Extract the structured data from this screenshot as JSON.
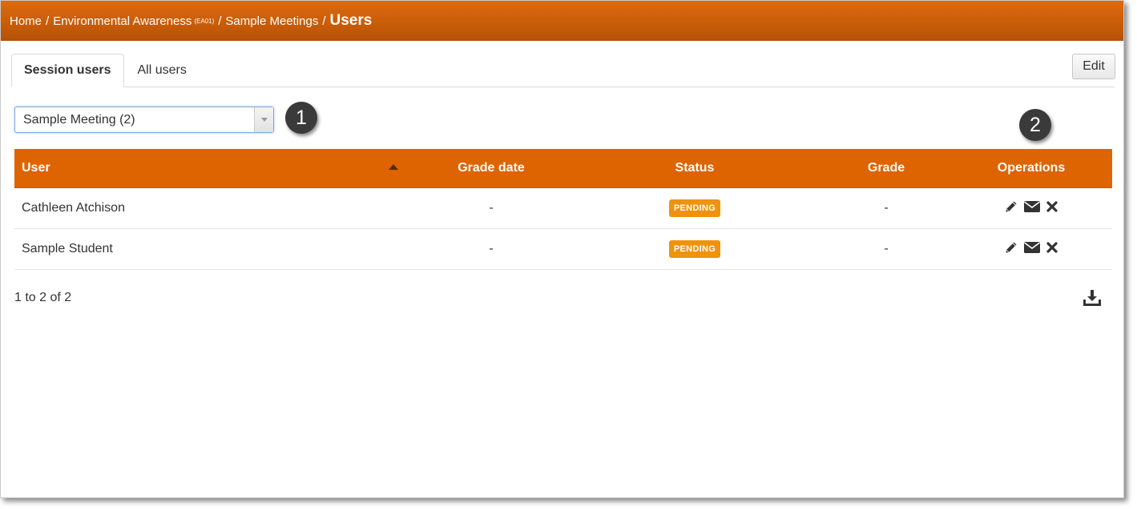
{
  "breadcrumb": {
    "home": "Home",
    "course": "Environmental Awareness",
    "course_code": "(EA01)",
    "section": "Sample Meetings",
    "current": "Users",
    "separator": "/"
  },
  "tabs": [
    {
      "label": "Session users",
      "active": true
    },
    {
      "label": "All users",
      "active": false
    }
  ],
  "toolbar": {
    "edit_label": "Edit"
  },
  "session_select": {
    "selected": "Sample Meeting (2)"
  },
  "callouts": [
    "1",
    "2"
  ],
  "table": {
    "columns": [
      "User",
      "Grade date",
      "Status",
      "Grade",
      "Operations"
    ],
    "sort": {
      "column": "User",
      "direction": "ascending"
    },
    "rows": [
      {
        "user": "Cathleen Atchison",
        "grade_date": "-",
        "status": "PENDING",
        "grade": "-",
        "operations": [
          "pencil-icon",
          "envelope-icon",
          "close-icon"
        ]
      },
      {
        "user": "Sample Student",
        "grade_date": "-",
        "status": "PENDING",
        "grade": "-",
        "operations": [
          "pencil-icon",
          "envelope-icon",
          "close-icon"
        ]
      }
    ]
  },
  "pagination": {
    "summary": "1 to 2 of 2"
  },
  "colors": {
    "brand_orange": "#dd6400",
    "badge_pending": "#f0920c",
    "callout": "#3a3a3a"
  },
  "icons": {
    "download": "download-icon"
  }
}
